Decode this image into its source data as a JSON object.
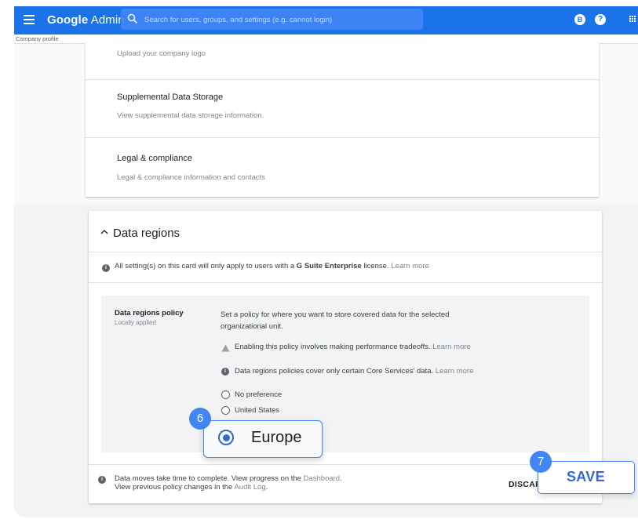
{
  "header": {
    "brand_google": "Google",
    "brand_admin": "Admin",
    "search_placeholder": "Search for users, groups, and settings (e.g. cannot login)",
    "account_initial": "B",
    "help_glyph": "?",
    "colors": {
      "bar": "#1a73e8",
      "search": "#4285f4"
    }
  },
  "breadcrumb": "Company profile",
  "upper_card": {
    "rows": [
      {
        "title": "",
        "description": "Upload your company logo"
      },
      {
        "title": "Supplemental Data Storage",
        "description": "View supplemental data storage information."
      },
      {
        "title": "Legal & compliance",
        "description": "Legal & compliance information and contacts"
      }
    ]
  },
  "data_regions": {
    "title": "Data regions",
    "notice_prefix": "All setting(s) on this card will only apply to users with a ",
    "notice_bold": "G Suite Enterprise",
    "notice_suffix": " license.",
    "notice_link": "Learn more",
    "policy": {
      "label": "Data regions policy",
      "sublabel": "Locally applied",
      "description": "Set a policy for where you want to store covered data for the selected organizational unit.",
      "warning": "Enabling this policy involves making performance tradeoffs.",
      "warning_link": "Learn more",
      "coverage": "Data regions policies cover only certain Core Services' data.",
      "coverage_link": "Learn more",
      "options": [
        "No preference",
        "United States",
        "Europe"
      ],
      "selected": "Europe"
    },
    "footer": {
      "line1_prefix": "Data moves take time to complete. View progress on the ",
      "line1_link": "Dashboard",
      "line1_suffix": ".",
      "line2_prefix": "View previous policy changes in the ",
      "line2_link": "Audit Log",
      "line2_suffix": ".",
      "discard_label": "DISCAR",
      "save_label": "SAVE"
    }
  },
  "steps": {
    "europe_step": "6",
    "save_step": "7"
  }
}
